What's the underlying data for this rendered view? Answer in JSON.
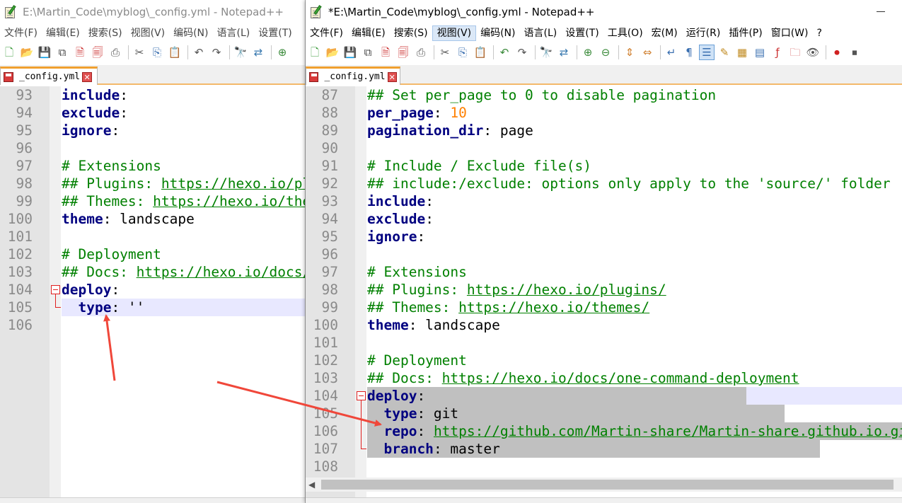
{
  "left_window": {
    "title": "E:\\Martin_Code\\myblog\\_config.yml - Notepad++",
    "menu": [
      "文件(F)",
      "编辑(E)",
      "搜索(S)",
      "视图(V)",
      "编码(N)",
      "语言(L)",
      "设置(T)"
    ],
    "tab": {
      "label": "_config.yml",
      "close": "✕"
    },
    "lines": [
      {
        "num": "93",
        "code": [
          {
            "t": "include",
            "s": "k"
          },
          {
            "t": ":"
          }
        ]
      },
      {
        "num": "94",
        "code": [
          {
            "t": "exclude",
            "s": "k"
          },
          {
            "t": ":"
          }
        ]
      },
      {
        "num": "95",
        "code": [
          {
            "t": "ignore",
            "s": "k"
          },
          {
            "t": ":"
          }
        ]
      },
      {
        "num": "96",
        "code": []
      },
      {
        "num": "97",
        "code": [
          {
            "t": "# Extensions",
            "s": "c"
          }
        ]
      },
      {
        "num": "98",
        "code": [
          {
            "t": "## Plugins: ",
            "s": "c"
          },
          {
            "t": "https://hexo.io/plugins/",
            "s": "u"
          }
        ]
      },
      {
        "num": "99",
        "code": [
          {
            "t": "## Themes: ",
            "s": "c"
          },
          {
            "t": "https://hexo.io/themes/",
            "s": "u"
          }
        ]
      },
      {
        "num": "100",
        "code": [
          {
            "t": "theme",
            "s": "k"
          },
          {
            "t": ": landscape"
          }
        ]
      },
      {
        "num": "101",
        "code": []
      },
      {
        "num": "102",
        "code": [
          {
            "t": "# Deployment",
            "s": "c"
          }
        ]
      },
      {
        "num": "103",
        "code": [
          {
            "t": "## Docs: ",
            "s": "c"
          },
          {
            "t": "https://hexo.io/docs/one-command-deployment",
            "s": "u"
          }
        ]
      },
      {
        "num": "104",
        "code": [
          {
            "t": "deploy",
            "s": "k"
          },
          {
            "t": ":"
          }
        ]
      },
      {
        "num": "105",
        "code": [
          {
            "t": "  "
          },
          {
            "t": "type",
            "s": "k"
          },
          {
            "t": ": ''"
          }
        ]
      },
      {
        "num": "106",
        "code": []
      }
    ]
  },
  "right_window": {
    "title": "*E:\\Martin_Code\\myblog\\_config.yml - Notepad++",
    "menu": [
      "文件(F)",
      "编辑(E)",
      "搜索(S)",
      "视图(V)",
      "编码(N)",
      "语言(L)",
      "设置(T)",
      "工具(O)",
      "宏(M)",
      "运行(R)",
      "插件(P)",
      "窗口(W)",
      "?"
    ],
    "active_menu": "视图(V)",
    "tab": {
      "label": "_config.yml",
      "close": "✕"
    },
    "lines": [
      {
        "num": "87",
        "code": [
          {
            "t": "## Set per_page to 0 to disable pagination",
            "s": "c"
          }
        ]
      },
      {
        "num": "88",
        "code": [
          {
            "t": "per_page",
            "s": "k"
          },
          {
            "t": ": "
          },
          {
            "t": "10",
            "s": "n"
          }
        ]
      },
      {
        "num": "89",
        "code": [
          {
            "t": "pagination_dir",
            "s": "k"
          },
          {
            "t": ": page"
          }
        ]
      },
      {
        "num": "90",
        "code": []
      },
      {
        "num": "91",
        "code": [
          {
            "t": "# Include / Exclude file(s)",
            "s": "c"
          }
        ]
      },
      {
        "num": "92",
        "code": [
          {
            "t": "## include:/exclude: options only apply to the 'source/' folder",
            "s": "c"
          }
        ]
      },
      {
        "num": "93",
        "code": [
          {
            "t": "include",
            "s": "k"
          },
          {
            "t": ":"
          }
        ]
      },
      {
        "num": "94",
        "code": [
          {
            "t": "exclude",
            "s": "k"
          },
          {
            "t": ":"
          }
        ]
      },
      {
        "num": "95",
        "code": [
          {
            "t": "ignore",
            "s": "k"
          },
          {
            "t": ":"
          }
        ]
      },
      {
        "num": "96",
        "code": []
      },
      {
        "num": "97",
        "code": [
          {
            "t": "# Extensions",
            "s": "c"
          }
        ]
      },
      {
        "num": "98",
        "code": [
          {
            "t": "## Plugins: ",
            "s": "c"
          },
          {
            "t": "https://hexo.io/plugins/",
            "s": "u"
          }
        ]
      },
      {
        "num": "99",
        "code": [
          {
            "t": "## Themes: ",
            "s": "c"
          },
          {
            "t": "https://hexo.io/themes/",
            "s": "u"
          }
        ]
      },
      {
        "num": "100",
        "code": [
          {
            "t": "theme",
            "s": "k"
          },
          {
            "t": ": landscape"
          }
        ]
      },
      {
        "num": "101",
        "code": []
      },
      {
        "num": "102",
        "code": [
          {
            "t": "# Deployment",
            "s": "c"
          }
        ]
      },
      {
        "num": "103",
        "code": [
          {
            "t": "## Docs: ",
            "s": "c"
          },
          {
            "t": "https://hexo.io/docs/one-command-deployment",
            "s": "u"
          }
        ]
      },
      {
        "num": "104",
        "code": [
          {
            "t": "deploy",
            "s": "k"
          },
          {
            "t": ":"
          }
        ]
      },
      {
        "num": "105",
        "code": [
          {
            "t": "  "
          },
          {
            "t": "type",
            "s": "k"
          },
          {
            "t": ": git"
          }
        ]
      },
      {
        "num": "106",
        "code": [
          {
            "t": "  "
          },
          {
            "t": "repo",
            "s": "k"
          },
          {
            "t": ": "
          },
          {
            "t": "https://github.com/Martin-share/Martin-share.github.io.git",
            "s": "u"
          }
        ]
      },
      {
        "num": "107",
        "code": [
          {
            "t": "  "
          },
          {
            "t": "branch",
            "s": "k"
          },
          {
            "t": ": master"
          }
        ]
      },
      {
        "num": "108",
        "code": []
      }
    ]
  },
  "colors": {
    "keyword": "#000080",
    "comment": "#008000",
    "number": "#ff8000",
    "fold_marker": "#e02020",
    "annotation_arrow": "#f0473a",
    "current_line": "#e8e8ff",
    "selection": "#c0c0c0",
    "tab_accent": "#f0a030"
  }
}
